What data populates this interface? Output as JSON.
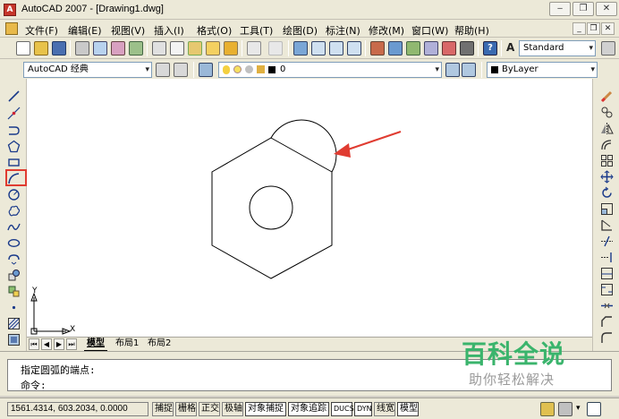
{
  "window": {
    "title": "AutoCAD 2007 - [Drawing1.dwg]",
    "controls": [
      "‒",
      "❐",
      "✕"
    ]
  },
  "menubar": {
    "items": [
      "文件(F)",
      "编辑(E)",
      "视图(V)",
      "插入(I)",
      "格式(O)",
      "工具(T)",
      "绘图(D)",
      "标注(N)",
      "修改(M)",
      "窗口(W)",
      "帮助(H)"
    ],
    "mdi_controls": [
      "_",
      "❐",
      "✕"
    ]
  },
  "toolbars": {
    "text_style": "Standard",
    "workspace": "AutoCAD 经典",
    "layer_name": "0",
    "color": "ByLayer"
  },
  "canvas": {
    "ucs_x_label": "X",
    "ucs_y_label": "Y"
  },
  "layout_tabs": {
    "tabs": [
      "模型",
      "布局1",
      "布局2"
    ],
    "active": "模型"
  },
  "command": {
    "previous_line": "指定圆弧的端点:",
    "prompt": "命令:"
  },
  "status": {
    "coordinates": "1561.4314, 603.2034, 0.0000",
    "buttons": [
      {
        "label": "捕捉",
        "on": false
      },
      {
        "label": "栅格",
        "on": false
      },
      {
        "label": "正交",
        "on": false
      },
      {
        "label": "极轴",
        "on": false
      },
      {
        "label": "对象捕捉",
        "on": true
      },
      {
        "label": "对象追踪",
        "on": true
      },
      {
        "label": "DUCS",
        "on": true
      },
      {
        "label": "DYN",
        "on": true
      },
      {
        "label": "线宽",
        "on": false
      },
      {
        "label": "模型",
        "on": true
      }
    ]
  },
  "watermark": {
    "main": "百科全说",
    "sub": "助你轻松解决"
  },
  "colors": {
    "highlight_box": "#e03c31",
    "annotation_arrow": "#e03c31",
    "watermark_green": "#3ab46c"
  },
  "icons": {
    "left_toolbar": [
      "line-icon",
      "construction-line-icon",
      "polyline-icon",
      "polygon-icon",
      "rectangle-icon",
      "arc-icon",
      "circle-icon",
      "revision-cloud-icon",
      "spline-icon",
      "ellipse-icon",
      "ellipse-arc-icon",
      "insert-block-icon",
      "make-block-icon",
      "point-icon",
      "hatch-icon",
      "region-icon"
    ],
    "right_toolbar": [
      "erase-icon",
      "copy-icon",
      "mirror-icon",
      "offset-icon",
      "array-icon",
      "move-icon",
      "rotate-icon",
      "scale-icon",
      "stretch-icon",
      "trim-icon",
      "extend-icon",
      "break-at-point-icon",
      "break-icon",
      "join-icon",
      "chamfer-icon",
      "fillet-icon"
    ]
  }
}
